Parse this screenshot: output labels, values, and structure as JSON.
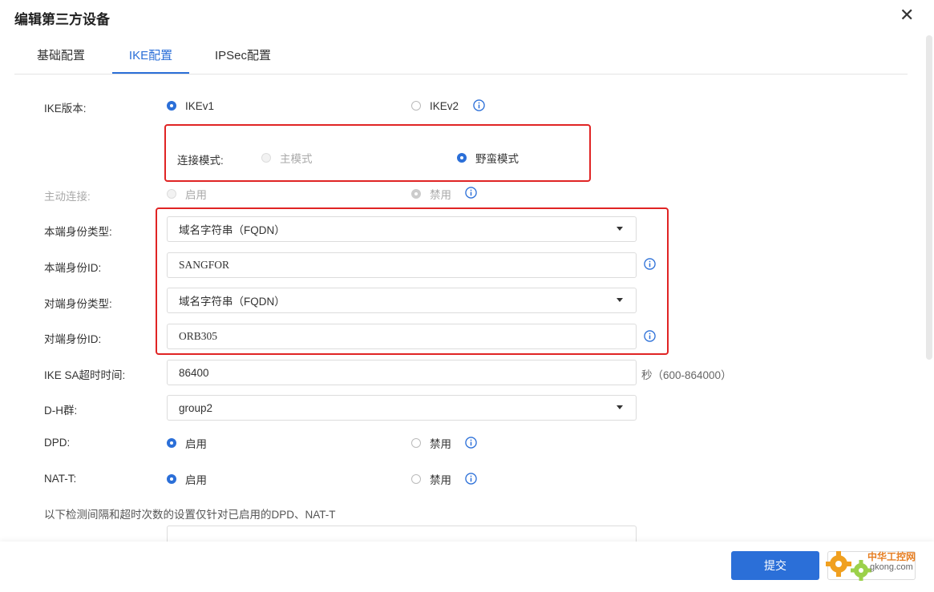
{
  "dialog": {
    "title": "编辑第三方设备",
    "close_glyph": "✕"
  },
  "tabs": [
    "基础配置",
    "IKE配置",
    "IPSec配置"
  ],
  "form": {
    "ike_version": {
      "label": "IKE版本:",
      "options": [
        "IKEv1",
        "IKEv2"
      ],
      "selected": "IKEv1"
    },
    "connect_mode": {
      "label": "连接模式:",
      "options": [
        "主模式",
        "野蛮模式"
      ],
      "selected": "野蛮模式"
    },
    "active_connect": {
      "label": "主动连接:",
      "options": [
        "启用",
        "禁用"
      ],
      "selected": "禁用"
    },
    "local_id_type": {
      "label": "本端身份类型:",
      "value": "域名字符串（FQDN）"
    },
    "local_id": {
      "label": "本端身份ID:",
      "value": "SANGFOR"
    },
    "peer_id_type": {
      "label": "对端身份类型:",
      "value": "域名字符串（FQDN）"
    },
    "peer_id": {
      "label": "对端身份ID:",
      "value": "ORB305"
    },
    "ike_sa_timeout": {
      "label": "IKE SA超时时间:",
      "value": "86400",
      "unit": "秒（600-864000）"
    },
    "dh_group": {
      "label": "D-H群:",
      "value": "group2"
    },
    "dpd": {
      "label": "DPD:",
      "options": [
        "启用",
        "禁用"
      ],
      "selected": "启用"
    },
    "nat_t": {
      "label": "NAT-T:",
      "options": [
        "启用",
        "禁用"
      ],
      "selected": "启用"
    },
    "note": "以下检测间隔和超时次数的设置仅针对已启用的DPD、NAT-T"
  },
  "buttons": {
    "submit": "提交",
    "cancel": ""
  },
  "watermark": {
    "title": "中华工控网",
    "url": "gkong.com"
  },
  "colors": {
    "accent": "#2b6fd8",
    "highlight": "#e02424"
  }
}
